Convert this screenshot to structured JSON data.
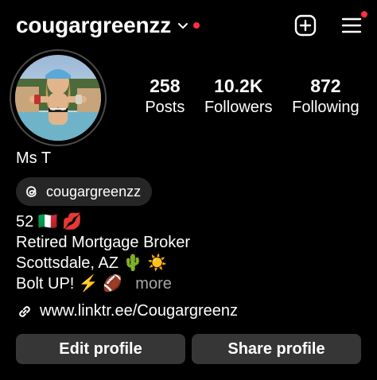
{
  "header": {
    "username": "cougargreenzz",
    "icons": {
      "dropdown": "chevron-down-icon",
      "create": "plus-square-icon",
      "menu": "hamburger-menu-icon"
    },
    "colors": {
      "notification": "#ff3040"
    }
  },
  "profile": {
    "avatar": "profile-photo",
    "display_name": "Ms T"
  },
  "stats": {
    "posts": {
      "value": "258",
      "label": "Posts"
    },
    "followers": {
      "value": "10.2K",
      "label": "Followers"
    },
    "following": {
      "value": "872",
      "label": "Following"
    }
  },
  "threads": {
    "handle": "cougargreenzz",
    "icon": "threads-icon"
  },
  "bio": {
    "line1": "52 🇮🇹 💋",
    "line2": "Retired Mortgage Broker",
    "line3": "Scottsdale, AZ 🌵 ☀️",
    "line4": "Bolt UP! ⚡️ 🏈",
    "more": "more"
  },
  "link": {
    "text": "www.linktr.ee/Cougargreenz",
    "icon": "link-icon"
  },
  "actions": {
    "edit_profile": "Edit profile",
    "share_profile": "Share profile"
  }
}
